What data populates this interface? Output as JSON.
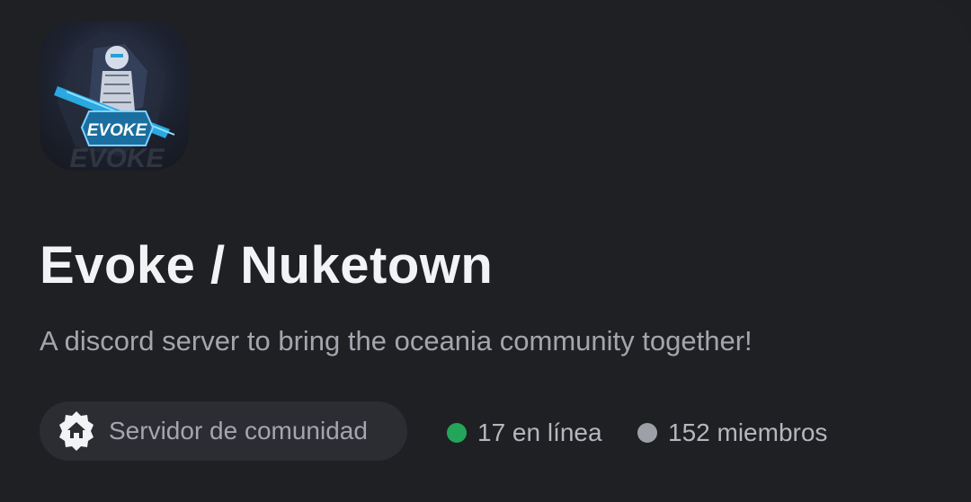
{
  "server": {
    "name": "Evoke / Nuketown",
    "description": "A discord server to bring the oceania community together!",
    "icon": "evoke-logo",
    "icon_text": "EVOKE"
  },
  "tag": {
    "icon": "home-badge-icon",
    "label": "Servidor de comunidad"
  },
  "stats": {
    "online": "17 en línea",
    "members": "152 miembros"
  },
  "colors": {
    "background": "#1f2024",
    "pill": "#2b2d33",
    "online": "#23a55a",
    "offline": "#9ea0a7",
    "title": "#f2f3f5",
    "muted": "#a4a6ad"
  }
}
